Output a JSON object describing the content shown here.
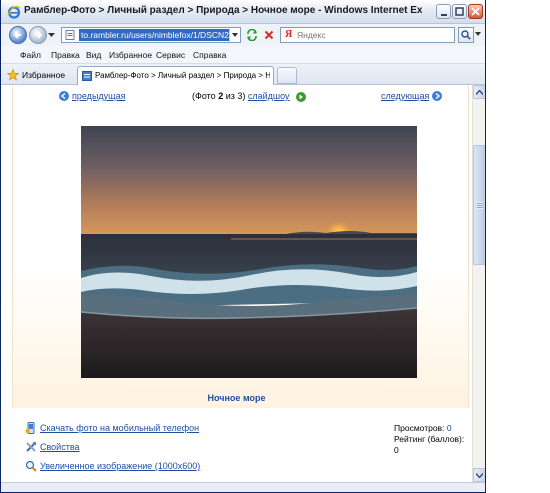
{
  "window": {
    "title": "Рамблер-Фото > Личный раздел > Природа > Ночное море - Windows Internet Explorer пред..."
  },
  "address_bar": {
    "url": "to.rambler.ru/users/nimblefox/1/DSCN2619/",
    "search_placeholder": "Яндекс"
  },
  "menu": {
    "items": [
      "Файл",
      "Правка",
      "Вид",
      "Избранное",
      "Сервис",
      "Справка"
    ]
  },
  "favorites": {
    "label": "Избранное"
  },
  "tab": {
    "label": "Рамблер-Фото > Личный раздел > Природа > Ноч..."
  },
  "photo_nav": {
    "prev_label": "предыдущая",
    "next_label": "следующая",
    "counter_prefix": "(Фото ",
    "counter_current": "2",
    "counter_mid": " из 3) ",
    "slideshow_label": "слайдшоу"
  },
  "photo": {
    "caption": "Ночное море"
  },
  "actions": [
    {
      "label": "Скачать фото на мобильный телефон",
      "icon": "mobile-download-icon"
    },
    {
      "label": "Свойства",
      "icon": "properties-icon"
    },
    {
      "label": "Увеличенное изображение (1000x600)",
      "icon": "zoom-icon"
    }
  ],
  "stats": {
    "views_label": "Просмотров:",
    "views_value": "0",
    "rating_label": "Рейтинг (баллов):",
    "rating_value": "0"
  },
  "colors": {
    "link": "#1f4fa3",
    "selection": "#316ac5",
    "panel_fade": "#fff3e0"
  }
}
